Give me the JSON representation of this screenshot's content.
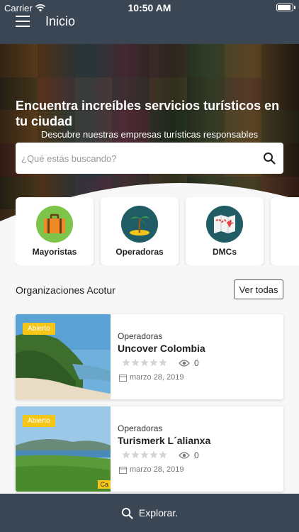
{
  "status_bar": {
    "carrier": "Carrier",
    "time": "10:50 AM"
  },
  "header": {
    "title": "Inicio",
    "menu_icon": "hamburger-menu-icon"
  },
  "hero": {
    "headline": "Encuentra increíbles servicios turísticos en tu ciudad",
    "subtitle": "Descubre nuestras empresas turísticas responsables",
    "search_placeholder": "¿Qué estás buscando?"
  },
  "categories": [
    {
      "label": "Mayoristas",
      "icon": "suitcase-icon",
      "color": "#7cc44a"
    },
    {
      "label": "Operadoras",
      "icon": "palm-island-icon",
      "color": "#1f5c63"
    },
    {
      "label": "DMCs",
      "icon": "map-icon",
      "color": "#1f5c63"
    }
  ],
  "section": {
    "title": "Organizaciones Acotur",
    "button": "Ver todas"
  },
  "organizations": [
    {
      "badge": "Abierto",
      "category": "Operadoras",
      "name": "Uncover Colombia",
      "rating": 0,
      "views": "0",
      "date": "marzo 28, 2019"
    },
    {
      "badge": "Abierto",
      "category": "Operadoras",
      "name": "Turismerk L´alianxa",
      "rating": 0,
      "views": "0",
      "date": "marzo 28, 2019",
      "corner_tag": "Ca"
    }
  ],
  "bottom_bar": {
    "label": "Explorar."
  },
  "colors": {
    "bar": "#3a4654",
    "badge": "#f5c518",
    "accent_green": "#7cc44a",
    "accent_teal": "#1f5c63"
  }
}
